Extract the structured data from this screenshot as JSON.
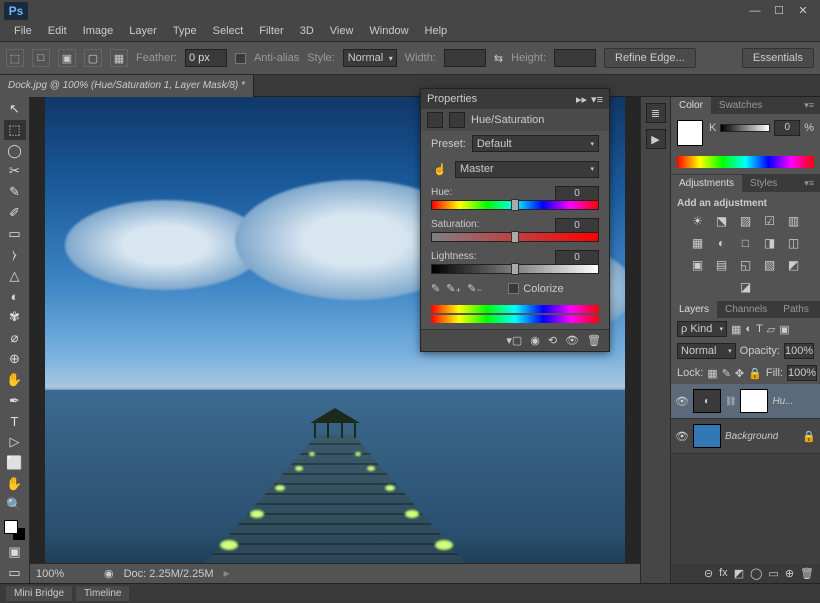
{
  "app": {
    "logo": "Ps"
  },
  "window_controls": {
    "min": "—",
    "max": "☐",
    "close": "✕"
  },
  "menu": [
    "File",
    "Edit",
    "Image",
    "Layer",
    "Type",
    "Select",
    "Filter",
    "3D",
    "View",
    "Window",
    "Help"
  ],
  "options_bar": {
    "feather_label": "Feather:",
    "feather_value": "0 px",
    "antialias_label": "Anti-alias",
    "style_label": "Style:",
    "style_value": "Normal",
    "width_label": "Width:",
    "height_label": "Height:",
    "refine_button": "Refine Edge...",
    "essentials": "Essentials"
  },
  "document_tab": "Dock.jpg @ 100% (Hue/Saturation 1, Layer Mask/8) *",
  "tools": [
    "↖",
    "⬚",
    "◯",
    "✂",
    "✎",
    "✐",
    "▭",
    "⧽",
    "△",
    "◐",
    "✾",
    "⌀",
    "⊕",
    "✋",
    "T",
    "▷",
    "⬜",
    "⊡",
    "✋",
    "🔍"
  ],
  "properties_panel": {
    "title": "Properties",
    "adjustment_name": "Hue/Saturation",
    "preset_label": "Preset:",
    "preset_value": "Default",
    "channel_value": "Master",
    "hue_label": "Hue:",
    "hue_value": "0",
    "saturation_label": "Saturation:",
    "saturation_value": "0",
    "lightness_label": "Lightness:",
    "lightness_value": "0",
    "colorize_label": "Colorize"
  },
  "color_panel": {
    "tabs": [
      "Color",
      "Swatches"
    ],
    "channel": "K",
    "value": "0",
    "unit": "%"
  },
  "adjustments_panel": {
    "tabs": [
      "Adjustments",
      "Styles"
    ],
    "title": "Add an adjustment",
    "icons": [
      "☀",
      "⬔",
      "▨",
      "☑",
      "▥",
      "▦",
      "◐",
      "□",
      "◨",
      "◫",
      "▣",
      "▤",
      "◱",
      "▧",
      "◩",
      "◪"
    ]
  },
  "layers_panel": {
    "tabs": [
      "Layers",
      "Channels",
      "Paths"
    ],
    "filter_label": "ρ Kind",
    "blend_mode": "Normal",
    "opacity_label": "Opacity:",
    "opacity_value": "100%",
    "lock_label": "Lock:",
    "fill_label": "Fill:",
    "fill_value": "100%",
    "layers": [
      {
        "name": "Hu...",
        "adjustment": true,
        "selected": true
      },
      {
        "name": "Background",
        "locked": true
      }
    ],
    "footer_icons": [
      "⊝",
      "fx",
      "◩",
      "◯",
      "▭",
      "⊕",
      "🗑"
    ]
  },
  "status": {
    "zoom": "100%",
    "doc_info": "Doc: 2.25M/2.25M"
  },
  "bottom_tabs": [
    "Mini Bridge",
    "Timeline"
  ]
}
